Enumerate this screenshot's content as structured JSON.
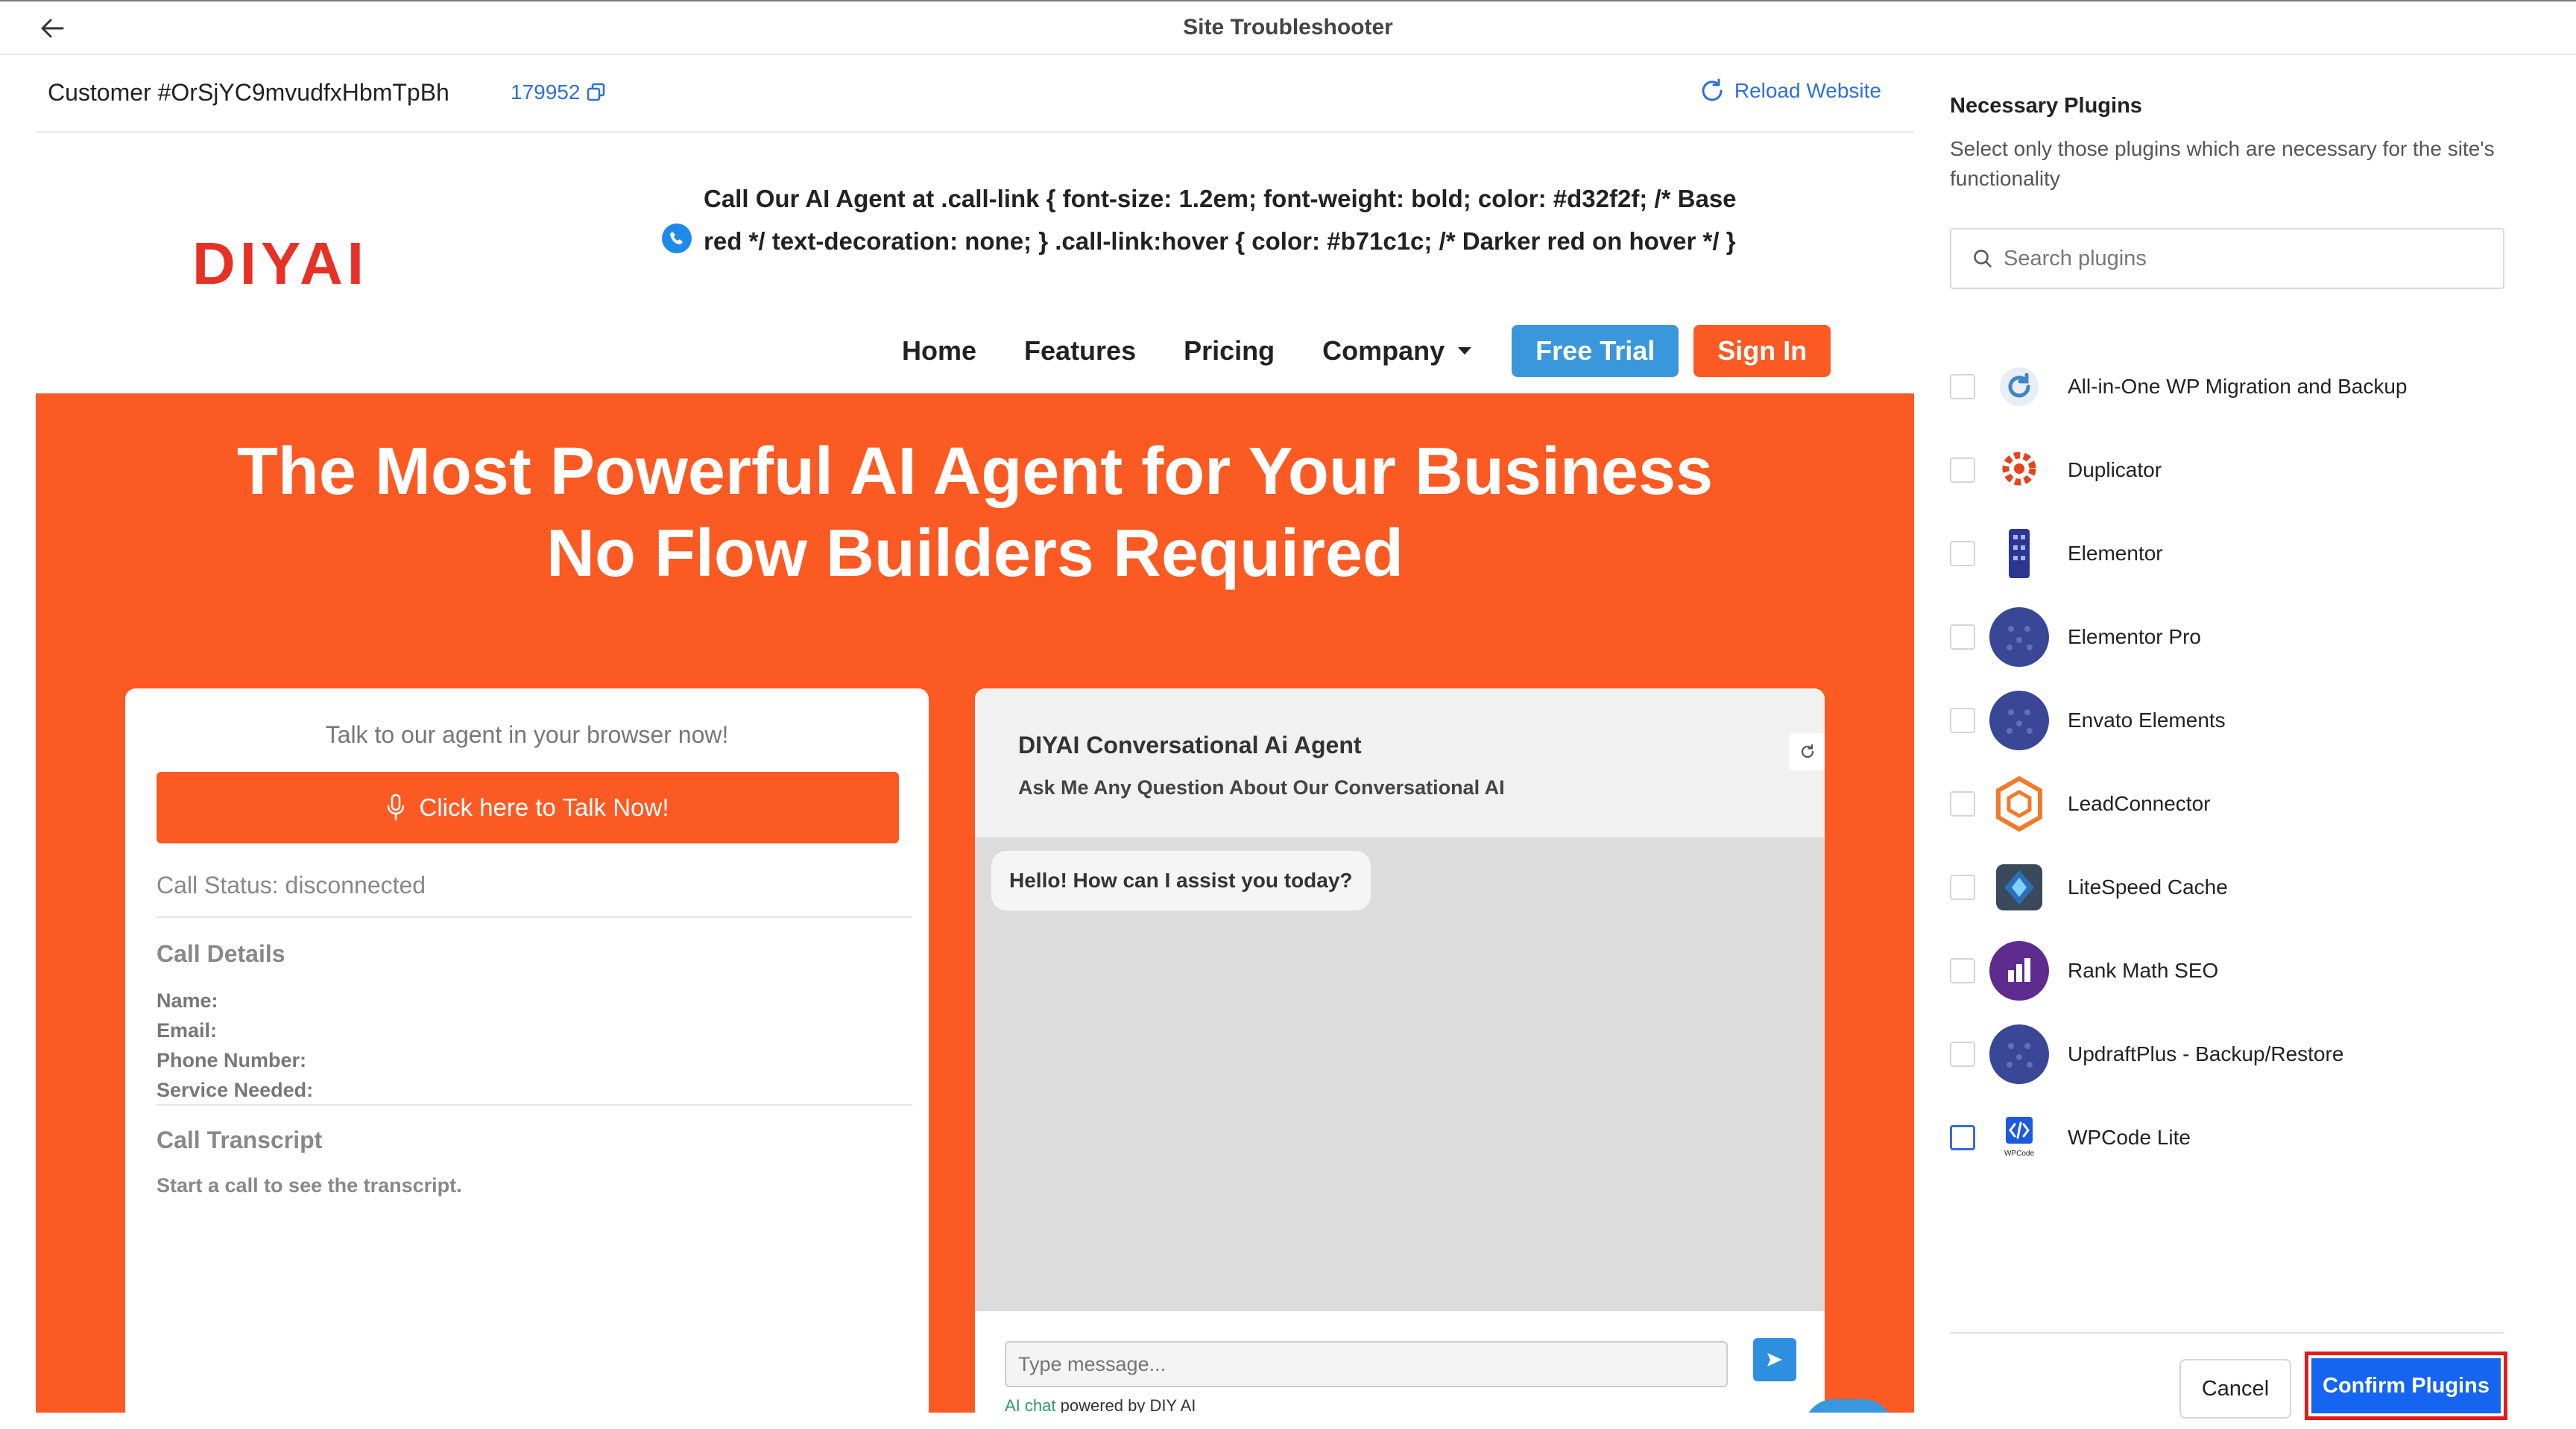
{
  "app": {
    "title": "Site Troubleshooter"
  },
  "customer": {
    "name": "Customer #OrSjYC9mvudfxHbmTpBh",
    "id": "179952",
    "reload_label": "Reload Website"
  },
  "site": {
    "logo_text": "DIYAI",
    "call_text": "Call Our AI Agent at .call-link { font-size: 1.2em; font-weight: bold; color: #d32f2f; /* Base red */ text-decoration: none; } .call-link:hover { color: #b71c1c; /* Darker red on hover */ }",
    "nav": {
      "home": "Home",
      "features": "Features",
      "pricing": "Pricing",
      "company": "Company",
      "free_trial": "Free Trial",
      "sign_in": "Sign In"
    },
    "hero": {
      "line1": "The Most Powerful AI Agent for Your Business",
      "line2": "No Flow Builders Required"
    },
    "talk": {
      "heading": "Talk to our agent in your browser now!",
      "button": "Click here to Talk Now!",
      "status": "Call Status: disconnected",
      "details_heading": "Call Details",
      "details": {
        "name": "Name:",
        "email": "Email:",
        "phone": "Phone Number:",
        "service": "Service Needed:"
      },
      "transcript_heading": "Call Transcript",
      "transcript_msg": "Start a call to see the transcript."
    },
    "chat": {
      "title": "DIYAI Conversational Ai Agent",
      "subtitle": "Ask Me Any Question About Our Conversational AI",
      "greeting": "Hello! How can I assist you today?",
      "input_placeholder": "Type message...",
      "powered_ai": "AI chat",
      "powered_rest": " powered by DIY AI"
    }
  },
  "panel": {
    "title": "Necessary Plugins",
    "description": "Select only those plugins which are necessary for the site's functionality",
    "search_placeholder": "Search plugins",
    "plugins": [
      {
        "name": "All-in-One WP Migration and Backup",
        "icon": "refresh-arrows-icon",
        "color": "#3e86c6"
      },
      {
        "name": "Duplicator",
        "icon": "gear-icon",
        "color": "#e8411e"
      },
      {
        "name": "Elementor",
        "icon": "building-icon",
        "color": "#2d3591"
      },
      {
        "name": "Elementor Pro",
        "icon": "dots-globe-icon",
        "color": "#3a4796"
      },
      {
        "name": "Envato Elements",
        "icon": "dots-globe-icon",
        "color": "#3a4796"
      },
      {
        "name": "LeadConnector",
        "icon": "hexagon-icon",
        "color": "#f47a2a"
      },
      {
        "name": "LiteSpeed Cache",
        "icon": "diamond-icon",
        "color": "#2a6fba"
      },
      {
        "name": "Rank Math SEO",
        "icon": "bar-chart-icon",
        "color": "#5d2c8e"
      },
      {
        "name": "UpdraftPlus - Backup/Restore",
        "icon": "dots-globe-icon",
        "color": "#3a4796"
      },
      {
        "name": "WPCode Lite",
        "icon": "code-icon",
        "color": "#1c5be0"
      }
    ],
    "cancel_label": "Cancel",
    "confirm_label": "Confirm Plugins",
    "accent": "#1565f0",
    "highlight": "#e21c1c"
  }
}
